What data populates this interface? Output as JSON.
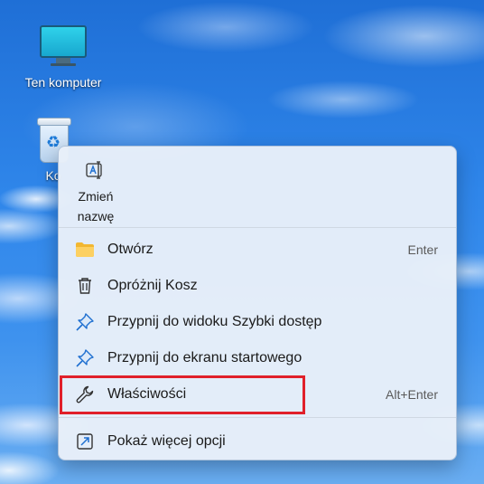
{
  "desktop": {
    "icons": [
      {
        "label": "Ten komputer",
        "icon": "computer-icon"
      },
      {
        "label": "Ko",
        "icon": "recycle-bin-icon"
      }
    ]
  },
  "context_menu": {
    "quick_actions": [
      {
        "label": "Zmień nazwę",
        "icon": "rename-icon"
      }
    ],
    "items": [
      {
        "label": "Otwórz",
        "shortcut": "Enter",
        "icon": "folder-icon"
      },
      {
        "label": "Opróżnij Kosz",
        "shortcut": "",
        "icon": "trash-icon"
      },
      {
        "label": "Przypnij do widoku Szybki dostęp",
        "shortcut": "",
        "icon": "pin-icon"
      },
      {
        "label": "Przypnij do ekranu startowego",
        "shortcut": "",
        "icon": "pin-icon"
      },
      {
        "label": "Właściwości",
        "shortcut": "Alt+Enter",
        "icon": "wrench-icon"
      }
    ],
    "footer_item": {
      "label": "Pokaż więcej opcji",
      "icon": "more-options-icon"
    },
    "highlighted_item": "Właściwości"
  },
  "colors": {
    "highlight_border": "#e0202a",
    "menu_background": "#e8f0f9",
    "accent_blue": "#1e6fd0"
  }
}
